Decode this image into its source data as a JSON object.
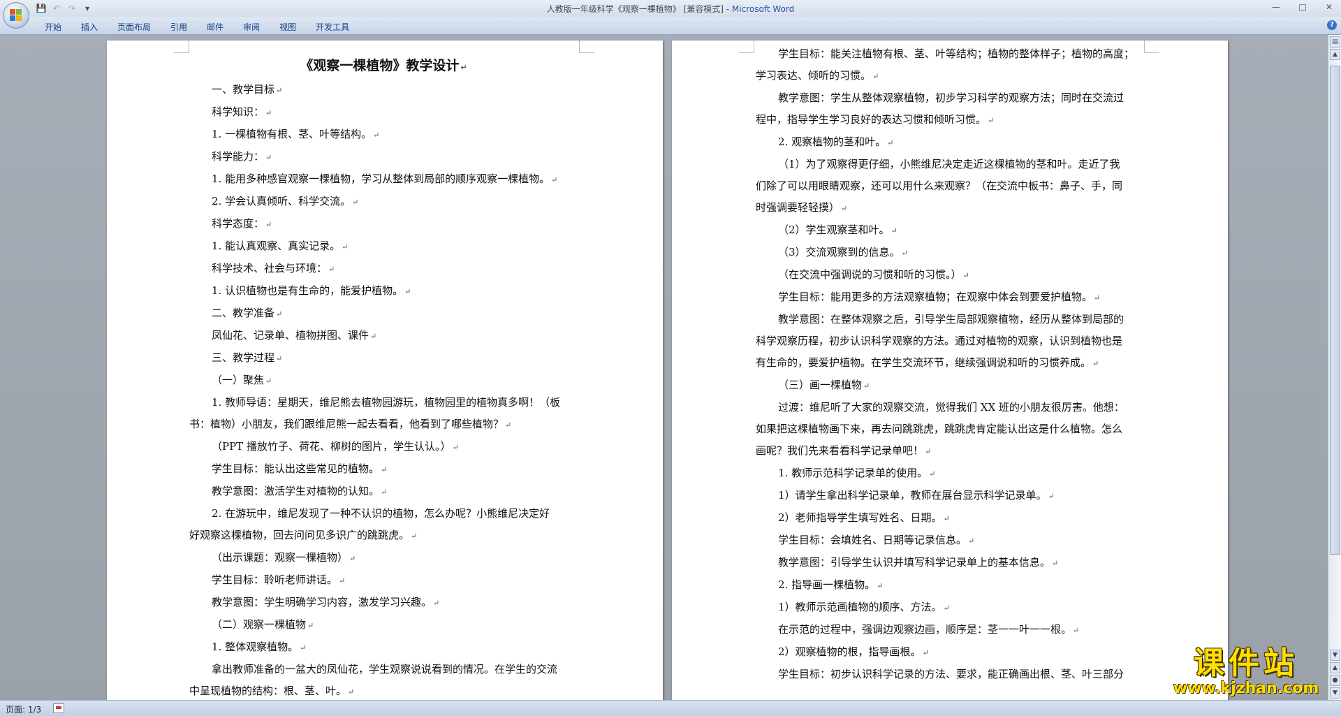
{
  "window": {
    "title": "人教版一年级科学《观察一棵植物》 [兼容模式] - ",
    "app_name": "Microsoft Word"
  },
  "quick_access": {
    "save_icon": "save-icon",
    "undo_icon": "undo-icon",
    "redo_icon": "redo-icon",
    "customize_icon": "customize-qat-icon"
  },
  "ribbon": {
    "tabs": [
      "开始",
      "插入",
      "页面布局",
      "引用",
      "邮件",
      "审阅",
      "视图",
      "开发工具"
    ],
    "help_label": "?"
  },
  "left_page": {
    "title": "《观察一棵植物》教学设计",
    "lines": [
      "一、教学目标",
      "科学知识：",
      "1. 一棵植物有根、茎、叶等结构。",
      "科学能力：",
      "1. 能用多种感官观察一棵植物，学习从整体到局部的顺序观察一棵植物。",
      "2. 学会认真倾听、科学交流。",
      "科学态度：",
      "1. 能认真观察、真实记录。",
      "科学技术、社会与环境：",
      "1. 认识植物也是有生命的，能爱护植物。",
      "二、教学准备",
      "凤仙花、记录单、植物拼图、课件",
      "三、教学过程",
      "（一）聚焦",
      "1. 教师导语：星期天，维尼熊去植物园游玩，植物园里的植物真多啊！（板",
      "书：植物）小朋友，我们跟维尼熊一起去看看，他看到了哪些植物？",
      "（PPT 播放竹子、荷花、柳树的图片，学生认认。）",
      "学生目标：能认出这些常见的植物。",
      "教学意图：激活学生对植物的认知。",
      "2. 在游玩中，维尼发现了一种不认识的植物，怎么办呢？小熊维尼决定好",
      "好观察这棵植物，回去问问见多识广的跳跳虎。",
      "（出示课题：观察一棵植物）",
      "学生目标：聆听老师讲话。",
      "教学意图：学生明确学习内容，激发学习兴趣。",
      "（二）观察一棵植物",
      "1. 整体观察植物。",
      "拿出教师准备的一盆大的凤仙花，学生观察说说看到的情况。在学生的交流",
      "中呈现植物的结构：根、茎、叶。"
    ]
  },
  "right_page": {
    "lines": [
      "学生目标：能关注植物有根、茎、叶等结构；植物的整体样子；植物的高度；",
      "学习表达、倾听的习惯。",
      "教学意图：学生从整体观察植物，初步学习科学的观察方法；同时在交流过",
      "程中，指导学生学习良好的表达习惯和倾听习惯。",
      "2. 观察植物的茎和叶。",
      "（1）为了观察得更仔细，小熊维尼决定走近这棵植物的茎和叶。走近了我",
      "们除了可以用眼睛观察，还可以用什么来观察？（在交流中板书：鼻子、手，同",
      "时强调要轻轻摸）",
      "（2）学生观察茎和叶。",
      "（3）交流观察到的信息。",
      "（在交流中强调说的习惯和听的习惯。）",
      "学生目标：能用更多的方法观察植物；在观察中体会到要爱护植物。",
      "教学意图：在整体观察之后，引导学生局部观察植物，经历从整体到局部的",
      "科学观察历程，初步认识科学观察的方法。通过对植物的观察，认识到植物也是",
      "有生命的，要爱护植物。在学生交流环节，继续强调说和听的习惯养成。",
      "（三）画一棵植物",
      "过渡：维尼听了大家的观察交流，觉得我们 XX 班的小朋友很厉害。他想：",
      "如果把这棵植物画下来，再去问跳跳虎，跳跳虎肯定能认出这是什么植物。怎么",
      "画呢？我们先来看看科学记录单吧！",
      "1. 教师示范科学记录单的使用。",
      "1）请学生拿出科学记录单，教师在展台显示科学记录单。",
      "2）老师指导学生填写姓名、日期。",
      "学生目标：会填姓名、日期等记录信息。",
      "教学意图：引导学生认识并填写科学记录单上的基本信息。",
      "2. 指导画一棵植物。",
      "1）教师示范画植物的顺序、方法。",
      "在示范的过程中，强调边观察边画，顺序是：茎一一叶一一根。",
      "2）观察植物的根，指导画根。",
      "学生目标：初步认识科学记录的方法、要求，能正确画出根、茎、叶三部分"
    ]
  },
  "status_bar": {
    "page_info": "页面: 1/3"
  },
  "watermark": {
    "main": "课件站",
    "url": "www.kjzhan.com"
  }
}
